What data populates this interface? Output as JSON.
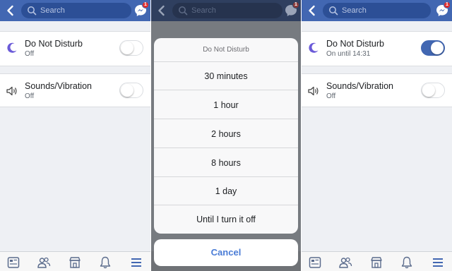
{
  "colors": {
    "brand_blue": "#4267b2",
    "toggle_on": "#4267b2",
    "badge_red": "#e02d2d",
    "cancel_blue": "#4a7cd6"
  },
  "screen_left": {
    "search": {
      "placeholder": "Search"
    },
    "messenger_badge": "1",
    "settings": [
      {
        "icon": "moon-icon",
        "title": "Do Not Disturb",
        "subtitle": "Off",
        "toggle_on": false
      },
      {
        "icon": "speaker-icon",
        "title": "Sounds/Vibration",
        "subtitle": "Off",
        "toggle_on": false
      }
    ]
  },
  "screen_middle": {
    "search": {
      "placeholder": "Search"
    },
    "messenger_badge": "1",
    "action_sheet": {
      "title": "Do Not Disturb",
      "options": [
        "30 minutes",
        "1 hour",
        "2 hours",
        "8 hours",
        "1 day",
        "Until I turn it off"
      ],
      "cancel_label": "Cancel"
    }
  },
  "screen_right": {
    "search": {
      "placeholder": "Search"
    },
    "messenger_badge": "1",
    "settings": [
      {
        "icon": "moon-icon",
        "title": "Do Not Disturb",
        "subtitle": "On until 14:31",
        "toggle_on": true
      },
      {
        "icon": "speaker-icon",
        "title": "Sounds/Vibration",
        "subtitle": "Off",
        "toggle_on": false
      }
    ]
  },
  "tabbar_icons": [
    "news-feed-icon",
    "friends-icon",
    "marketplace-icon",
    "notifications-bell-icon",
    "menu-icon"
  ]
}
